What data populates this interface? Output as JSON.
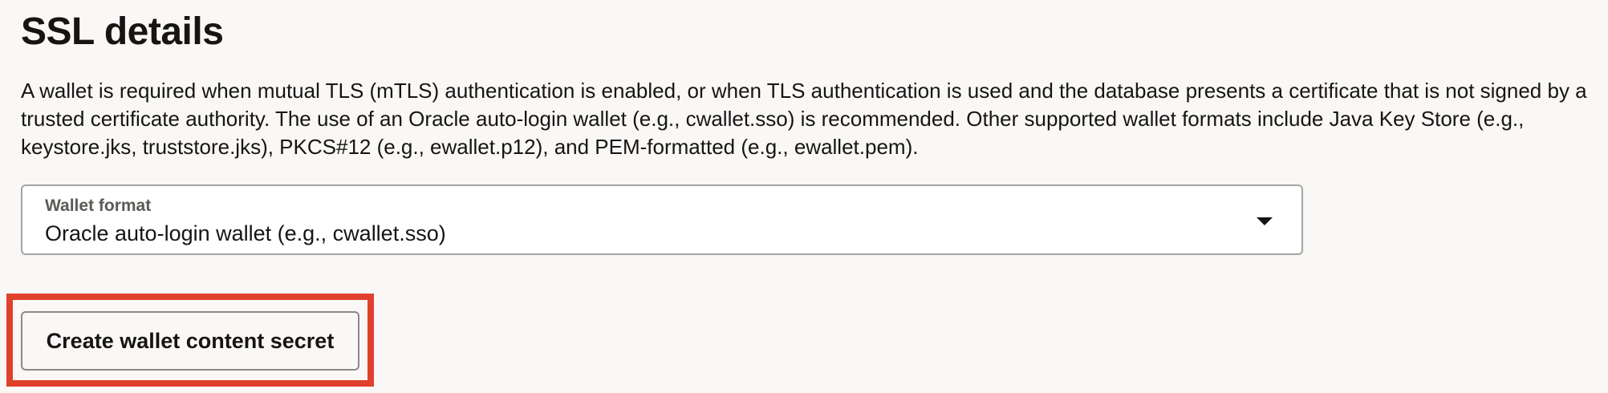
{
  "section": {
    "title": "SSL details",
    "description": "A wallet is required when mutual TLS (mTLS) authentication is enabled, or when TLS authentication is used and the database presents a certificate that is not signed by a trusted certificate authority. The use of an Oracle auto-login wallet (e.g., cwallet.sso) is recommended. Other supported wallet formats include Java Key Store (e.g., keystore.jks, truststore.jks), PKCS#12 (e.g., ewallet.p12), and PEM-formatted (e.g., ewallet.pem)."
  },
  "wallet_format": {
    "label": "Wallet format",
    "selected_value": "Oracle auto-login wallet (e.g., cwallet.sso)",
    "icon": "chevron-down-icon"
  },
  "actions": {
    "create_secret_label": "Create wallet content secret"
  },
  "colors": {
    "highlight_border": "#e0412c",
    "background": "#f9f8f6",
    "text": "#161513"
  }
}
